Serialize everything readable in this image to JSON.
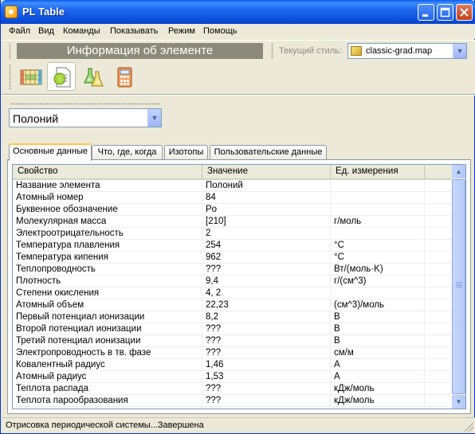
{
  "window": {
    "title": "PL Table"
  },
  "menu": [
    "Файл",
    "Вид",
    "Команды",
    "Показывать",
    "Режим",
    "Помощь"
  ],
  "toolbar": {
    "banner": "Информация об элементе",
    "style_label": "Текущий стиль:",
    "style_value": "classic-grad.map",
    "buttons": [
      "periodic-table-icon",
      "element-info-icon",
      "chemistry-flask-icon",
      "calculator-icon"
    ]
  },
  "element_select": {
    "value": "Полоний"
  },
  "tabs": [
    "Основные данные",
    "Что, где, когда",
    "Изотопы",
    "Пользовательские данные"
  ],
  "table": {
    "columns": [
      "Свойство",
      "Значение",
      "Ед. измерения"
    ],
    "rows": [
      [
        "Название элемента",
        "Полоний",
        ""
      ],
      [
        "Атомный номер",
        "84",
        ""
      ],
      [
        "Буквенное обозначение",
        "Po",
        ""
      ],
      [
        "Молекулярная масса",
        "[210]",
        "г/моль"
      ],
      [
        "Электроотрицательность",
        "2",
        ""
      ],
      [
        "Температура плавления",
        "254",
        "°C"
      ],
      [
        "Температура кипения",
        "962",
        "°C"
      ],
      [
        "Теплопроводность",
        "???",
        "Вт/(моль·K)"
      ],
      [
        "Плотность",
        "9,4",
        "г/(см^3)"
      ],
      [
        "Степени окисления",
        "4, 2",
        ""
      ],
      [
        "Атомный объем",
        "22,23",
        "(см^3)/моль"
      ],
      [
        "Первый потенциал ионизации",
        "8,2",
        "В"
      ],
      [
        "Второй потенциал ионизации",
        "???",
        "В"
      ],
      [
        "Третий потенциал ионизации",
        "???",
        "В"
      ],
      [
        "Электропроводность в тв. фазе",
        "???",
        "см/м"
      ],
      [
        "Ковалентный радиус",
        "1,46",
        "A"
      ],
      [
        "Атомный радиус",
        "1,53",
        "A"
      ],
      [
        "Теплота распада",
        "???",
        "кДж/моль"
      ],
      [
        "Теплота парообразования",
        "???",
        "кДж/моль"
      ]
    ]
  },
  "status": {
    "text": "Отрисовка периодической системы...Завершена"
  },
  "colors": {
    "title_bar": "#0a4fd9",
    "banner": "#8c8a7b",
    "active_tab_accent": "#ffc83c"
  }
}
